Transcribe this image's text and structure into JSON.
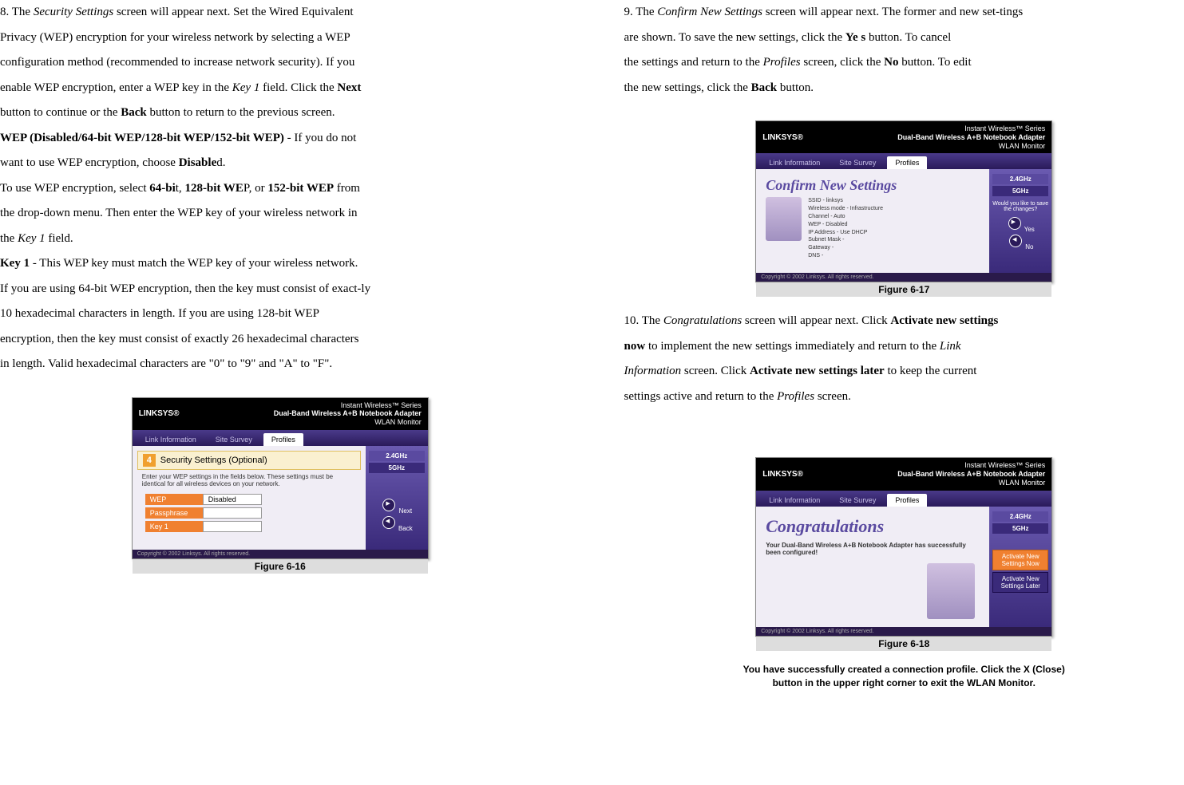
{
  "left": {
    "p1_a": "8. The ",
    "p1_b": "Security Settings",
    "p1_c": " screen will appear next. Set the Wired Equivalent",
    "p2": "Privacy (WEP) encryption for your wireless network by selecting a WEP",
    "p3": "configuration method (recommended to increase network security). If you",
    "p4_a": "enable WEP encryption, enter a WEP key in the ",
    "p4_b": "Key 1",
    "p4_c": " field. Click the ",
    "p4_d": "Next",
    "p5_a": "button to continue or the ",
    "p5_b": "Back",
    "p5_c": " button to return to the previous screen.",
    "p6_a": "WEP (Disabled/64-bit WEP/128-bit WEP/152-bit WEP)",
    "p6_b": " - If you do not",
    "p7_a": "want to use WEP encryption, choose ",
    "p7_b": "Disable",
    "p7_c": "d.",
    "p8_a": "To use WEP encryption, select ",
    "p8_b": "64-bi",
    "p8_c": "t, ",
    "p8_d": "128-bit WE",
    "p8_e": "P, or ",
    "p8_f": "152-bit WEP",
    "p8_g": " from",
    "p9": "the drop-down menu. Then enter the WEP key of your wireless network in",
    "p10_a": "the ",
    "p10_b": "Key 1",
    "p10_c": " field.",
    "p11_a": "Key 1",
    "p11_b": " - This WEP key must match the WEP key of your wireless network.",
    "p12": "If you are using 64-bit WEP encryption, then the key must consist of exact-ly",
    "p13": "10 hexadecimal characters in length. If you are using 128-bit WEP",
    "p14": "encryption, then the key must consist of exactly 26 hexadecimal characters",
    "p15": "in length. Valid hexadecimal characters are \"0\" to \"9\" and \"A\" to \"F\"."
  },
  "right": {
    "p1_a": "9. The ",
    "p1_b": "Confirm New Settings",
    "p1_c": " screen will appear next. The former and new set-tings",
    "p2_a": "are shown. To save the new settings, click the ",
    "p2_b": "Ye s",
    "p2_c": " button. To cancel",
    "p3_a": "the settings and return to the ",
    "p3_b": "Profiles",
    "p3_c": " screen, click the ",
    "p3_d": "No",
    "p3_e": " button. To edit",
    "p4_a": "the new settings, click the ",
    "p4_b": "Back",
    "p4_c": " button.",
    "p5_a": "10. The ",
    "p5_b": "Congratulations",
    "p5_c": " screen will appear next. Click ",
    "p5_d": "Activate new settings",
    "p6_a": "now",
    "p6_b": " to implement the new settings immediately and return to the ",
    "p6_c": "Link",
    "p7_a": "Information",
    "p7_b": " screen. Click ",
    "p7_c": "Activate new settings later",
    "p7_d": " to keep the current",
    "p8_a": "settings active and return to the ",
    "p8_b": "Profiles",
    "p8_c": " screen."
  },
  "fig16": {
    "caption": "Figure 6-16",
    "brand": "LINKSYS®",
    "series": "Instant Wireless™ Series",
    "product": "Dual-Band Wireless A+B Notebook Adapter",
    "monitor": "WLAN Monitor",
    "tab1": "Link Information",
    "tab2": "Site Survey",
    "tab3": "Profiles",
    "step": "4",
    "title": "Security Settings (Optional)",
    "desc": "Enter your WEP settings in the fields below. These settings must be identical for all wireless devices on your network.",
    "badge24": "2.4GHz",
    "badge5": "5GHz",
    "field_wep": "WEP",
    "field_wep_val": "Disabled",
    "field_pass": "Passphrase",
    "field_key1": "Key 1",
    "next": "Next",
    "back": "Back",
    "footer": "Copyright © 2002 Linksys. All rights reserved."
  },
  "fig17": {
    "caption": "Figure 6-17",
    "brand": "LINKSYS®",
    "series": "Instant Wireless™ Series",
    "product": "Dual-Band Wireless A+B Notebook Adapter",
    "monitor": "WLAN Monitor",
    "tab1": "Link Information",
    "tab2": "Site Survey",
    "tab3": "Profiles",
    "title": "Confirm New Settings",
    "badge24": "2.4GHz",
    "badge5": "5GHz",
    "s1": "SSID",
    "s1v": "- linksys",
    "s2": "Wireless mode",
    "s2v": "- Infrastructure",
    "s3": "Channel",
    "s3v": "- Auto",
    "s4": "WEP",
    "s4v": "- Disabled",
    "s5": "IP Address",
    "s5v": "- Use DHCP",
    "s6": "Subnet Mask",
    "s6v": "-",
    "s7": "Gateway",
    "s7v": "-",
    "s8": "DNS",
    "s8v": "-",
    "question": "Would you like to save the changes?",
    "yes": "Yes",
    "no": "No",
    "footer": "Copyright © 2002 Linksys. All rights reserved."
  },
  "fig18": {
    "caption": "Figure 6-18",
    "brand": "LINKSYS®",
    "series": "Instant Wireless™ Series",
    "product": "Dual-Band Wireless A+B Notebook Adapter",
    "monitor": "WLAN Monitor",
    "tab1": "Link Information",
    "tab2": "Site Survey",
    "tab3": "Profiles",
    "title": "Congratulations",
    "subtitle": "Your Dual-Band Wireless A+B Notebook Adapter has successfully been configured!",
    "badge24": "2.4GHz",
    "badge5": "5GHz",
    "btn1": "Activate New Settings Now",
    "btn2": "Activate New Settings Later",
    "footer": "Copyright © 2002 Linksys. All rights reserved."
  },
  "note": {
    "l1": "You have successfully created a connection profile. Click the X (Close)",
    "l2": "button in the upper right corner to exit the WLAN Monitor."
  }
}
